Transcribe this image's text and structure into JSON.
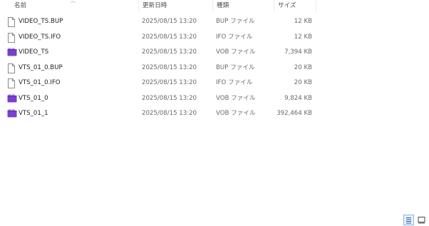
{
  "columns": {
    "name": "名前",
    "date": "更新日時",
    "type": "種類",
    "size": "サイズ"
  },
  "icons": {
    "sort": "sort-up-icon",
    "doc": "document-icon",
    "vob": "video-file-icon",
    "details_view": "details-view-icon",
    "large_icons_view": "large-icons-view-icon"
  },
  "colors": {
    "vob_icon": "#7a3fd0",
    "selected_toggle": "#e5f1fb"
  },
  "files": [
    {
      "name": "VIDEO_TS.BUP",
      "date": "2025/08/15 13:20",
      "type": "BUP ファイル",
      "size": "12 KB",
      "icon": "doc"
    },
    {
      "name": "VIDEO_TS.IFO",
      "date": "2025/08/15 13:20",
      "type": "IFO ファイル",
      "size": "12 KB",
      "icon": "doc"
    },
    {
      "name": "VIDEO_TS",
      "date": "2025/08/15 13:20",
      "type": "VOB ファイル",
      "size": "7,394 KB",
      "icon": "vob"
    },
    {
      "name": "VTS_01_0.BUP",
      "date": "2025/08/15 13:20",
      "type": "BUP ファイル",
      "size": "20 KB",
      "icon": "doc"
    },
    {
      "name": "VTS_01_0.IFO",
      "date": "2025/08/15 13:20",
      "type": "IFO ファイル",
      "size": "20 KB",
      "icon": "doc"
    },
    {
      "name": "VTS_01_0",
      "date": "2025/08/15 13:20",
      "type": "VOB ファイル",
      "size": "9,824 KB",
      "icon": "vob"
    },
    {
      "name": "VTS_01_1",
      "date": "2025/08/15 13:20",
      "type": "VOB ファイル",
      "size": "392,464 KB",
      "icon": "vob"
    }
  ]
}
